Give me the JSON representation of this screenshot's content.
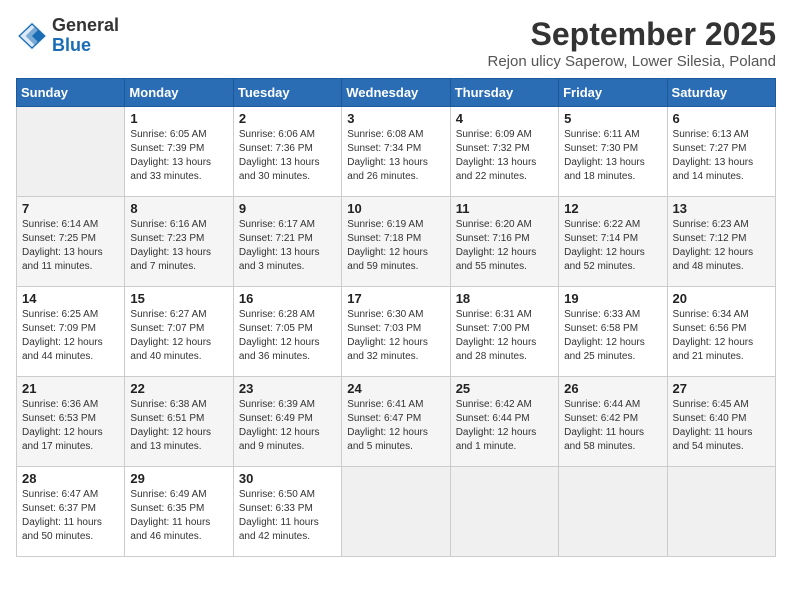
{
  "logo": {
    "general": "General",
    "blue": "Blue"
  },
  "header": {
    "month": "September 2025",
    "location": "Rejon ulicy Saperow, Lower Silesia, Poland"
  },
  "weekdays": [
    "Sunday",
    "Monday",
    "Tuesday",
    "Wednesday",
    "Thursday",
    "Friday",
    "Saturday"
  ],
  "weeks": [
    [
      {
        "day": null
      },
      {
        "day": 1,
        "sunrise": "Sunrise: 6:05 AM",
        "sunset": "Sunset: 7:39 PM",
        "daylight": "Daylight: 13 hours and 33 minutes."
      },
      {
        "day": 2,
        "sunrise": "Sunrise: 6:06 AM",
        "sunset": "Sunset: 7:36 PM",
        "daylight": "Daylight: 13 hours and 30 minutes."
      },
      {
        "day": 3,
        "sunrise": "Sunrise: 6:08 AM",
        "sunset": "Sunset: 7:34 PM",
        "daylight": "Daylight: 13 hours and 26 minutes."
      },
      {
        "day": 4,
        "sunrise": "Sunrise: 6:09 AM",
        "sunset": "Sunset: 7:32 PM",
        "daylight": "Daylight: 13 hours and 22 minutes."
      },
      {
        "day": 5,
        "sunrise": "Sunrise: 6:11 AM",
        "sunset": "Sunset: 7:30 PM",
        "daylight": "Daylight: 13 hours and 18 minutes."
      },
      {
        "day": 6,
        "sunrise": "Sunrise: 6:13 AM",
        "sunset": "Sunset: 7:27 PM",
        "daylight": "Daylight: 13 hours and 14 minutes."
      }
    ],
    [
      {
        "day": 7,
        "sunrise": "Sunrise: 6:14 AM",
        "sunset": "Sunset: 7:25 PM",
        "daylight": "Daylight: 13 hours and 11 minutes."
      },
      {
        "day": 8,
        "sunrise": "Sunrise: 6:16 AM",
        "sunset": "Sunset: 7:23 PM",
        "daylight": "Daylight: 13 hours and 7 minutes."
      },
      {
        "day": 9,
        "sunrise": "Sunrise: 6:17 AM",
        "sunset": "Sunset: 7:21 PM",
        "daylight": "Daylight: 13 hours and 3 minutes."
      },
      {
        "day": 10,
        "sunrise": "Sunrise: 6:19 AM",
        "sunset": "Sunset: 7:18 PM",
        "daylight": "Daylight: 12 hours and 59 minutes."
      },
      {
        "day": 11,
        "sunrise": "Sunrise: 6:20 AM",
        "sunset": "Sunset: 7:16 PM",
        "daylight": "Daylight: 12 hours and 55 minutes."
      },
      {
        "day": 12,
        "sunrise": "Sunrise: 6:22 AM",
        "sunset": "Sunset: 7:14 PM",
        "daylight": "Daylight: 12 hours and 52 minutes."
      },
      {
        "day": 13,
        "sunrise": "Sunrise: 6:23 AM",
        "sunset": "Sunset: 7:12 PM",
        "daylight": "Daylight: 12 hours and 48 minutes."
      }
    ],
    [
      {
        "day": 14,
        "sunrise": "Sunrise: 6:25 AM",
        "sunset": "Sunset: 7:09 PM",
        "daylight": "Daylight: 12 hours and 44 minutes."
      },
      {
        "day": 15,
        "sunrise": "Sunrise: 6:27 AM",
        "sunset": "Sunset: 7:07 PM",
        "daylight": "Daylight: 12 hours and 40 minutes."
      },
      {
        "day": 16,
        "sunrise": "Sunrise: 6:28 AM",
        "sunset": "Sunset: 7:05 PM",
        "daylight": "Daylight: 12 hours and 36 minutes."
      },
      {
        "day": 17,
        "sunrise": "Sunrise: 6:30 AM",
        "sunset": "Sunset: 7:03 PM",
        "daylight": "Daylight: 12 hours and 32 minutes."
      },
      {
        "day": 18,
        "sunrise": "Sunrise: 6:31 AM",
        "sunset": "Sunset: 7:00 PM",
        "daylight": "Daylight: 12 hours and 28 minutes."
      },
      {
        "day": 19,
        "sunrise": "Sunrise: 6:33 AM",
        "sunset": "Sunset: 6:58 PM",
        "daylight": "Daylight: 12 hours and 25 minutes."
      },
      {
        "day": 20,
        "sunrise": "Sunrise: 6:34 AM",
        "sunset": "Sunset: 6:56 PM",
        "daylight": "Daylight: 12 hours and 21 minutes."
      }
    ],
    [
      {
        "day": 21,
        "sunrise": "Sunrise: 6:36 AM",
        "sunset": "Sunset: 6:53 PM",
        "daylight": "Daylight: 12 hours and 17 minutes."
      },
      {
        "day": 22,
        "sunrise": "Sunrise: 6:38 AM",
        "sunset": "Sunset: 6:51 PM",
        "daylight": "Daylight: 12 hours and 13 minutes."
      },
      {
        "day": 23,
        "sunrise": "Sunrise: 6:39 AM",
        "sunset": "Sunset: 6:49 PM",
        "daylight": "Daylight: 12 hours and 9 minutes."
      },
      {
        "day": 24,
        "sunrise": "Sunrise: 6:41 AM",
        "sunset": "Sunset: 6:47 PM",
        "daylight": "Daylight: 12 hours and 5 minutes."
      },
      {
        "day": 25,
        "sunrise": "Sunrise: 6:42 AM",
        "sunset": "Sunset: 6:44 PM",
        "daylight": "Daylight: 12 hours and 1 minute."
      },
      {
        "day": 26,
        "sunrise": "Sunrise: 6:44 AM",
        "sunset": "Sunset: 6:42 PM",
        "daylight": "Daylight: 11 hours and 58 minutes."
      },
      {
        "day": 27,
        "sunrise": "Sunrise: 6:45 AM",
        "sunset": "Sunset: 6:40 PM",
        "daylight": "Daylight: 11 hours and 54 minutes."
      }
    ],
    [
      {
        "day": 28,
        "sunrise": "Sunrise: 6:47 AM",
        "sunset": "Sunset: 6:37 PM",
        "daylight": "Daylight: 11 hours and 50 minutes."
      },
      {
        "day": 29,
        "sunrise": "Sunrise: 6:49 AM",
        "sunset": "Sunset: 6:35 PM",
        "daylight": "Daylight: 11 hours and 46 minutes."
      },
      {
        "day": 30,
        "sunrise": "Sunrise: 6:50 AM",
        "sunset": "Sunset: 6:33 PM",
        "daylight": "Daylight: 11 hours and 42 minutes."
      },
      {
        "day": null
      },
      {
        "day": null
      },
      {
        "day": null
      },
      {
        "day": null
      }
    ]
  ]
}
